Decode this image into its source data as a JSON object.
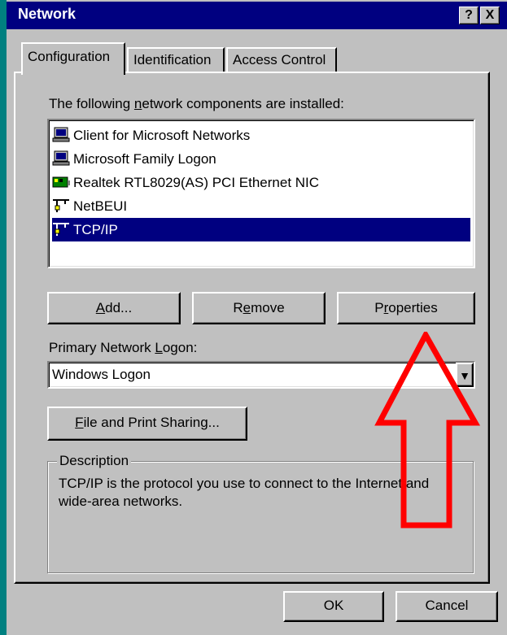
{
  "window": {
    "title": "Network",
    "help_button": "?",
    "close_button": "X"
  },
  "tabs": [
    {
      "label": "Configuration",
      "active": true
    },
    {
      "label": "Identification",
      "active": false
    },
    {
      "label": "Access Control",
      "active": false
    }
  ],
  "components": {
    "label_pre": "The following ",
    "label_accel": "n",
    "label_post": "etwork components are installed:",
    "items": [
      {
        "label": "Client for Microsoft Networks",
        "icon": "client-network-icon",
        "selected": false
      },
      {
        "label": "Microsoft Family Logon",
        "icon": "client-network-icon",
        "selected": false
      },
      {
        "label": "Realtek RTL8029(AS) PCI Ethernet NIC",
        "icon": "network-adapter-icon",
        "selected": false
      },
      {
        "label": "NetBEUI",
        "icon": "protocol-icon",
        "selected": false
      },
      {
        "label": "TCP/IP",
        "icon": "protocol-icon",
        "selected": true
      }
    ]
  },
  "buttons": {
    "add_accel": "A",
    "add_rest": "dd...",
    "remove_pre": "R",
    "remove_accel": "e",
    "remove_post": "move",
    "properties_pre": "P",
    "properties_accel": "r",
    "properties_post": "operties",
    "file_sharing_accel": "F",
    "file_sharing_rest": "ile and Print Sharing...",
    "ok": "OK",
    "cancel": "Cancel"
  },
  "primary_logon": {
    "label_pre": "Primary Network ",
    "label_accel": "L",
    "label_post": "ogon:",
    "value": "Windows Logon",
    "dropdown_icon": "chevron-down-icon"
  },
  "description": {
    "label": "Description",
    "text": "TCP/IP is the protocol you use to connect to the Internet and wide-area networks."
  },
  "annotation": {
    "arrow_color": "#ff0000",
    "shape": "up-arrow"
  },
  "colors": {
    "titlebar": "#000080",
    "face": "#c0c0c0",
    "selection": "#000080"
  }
}
